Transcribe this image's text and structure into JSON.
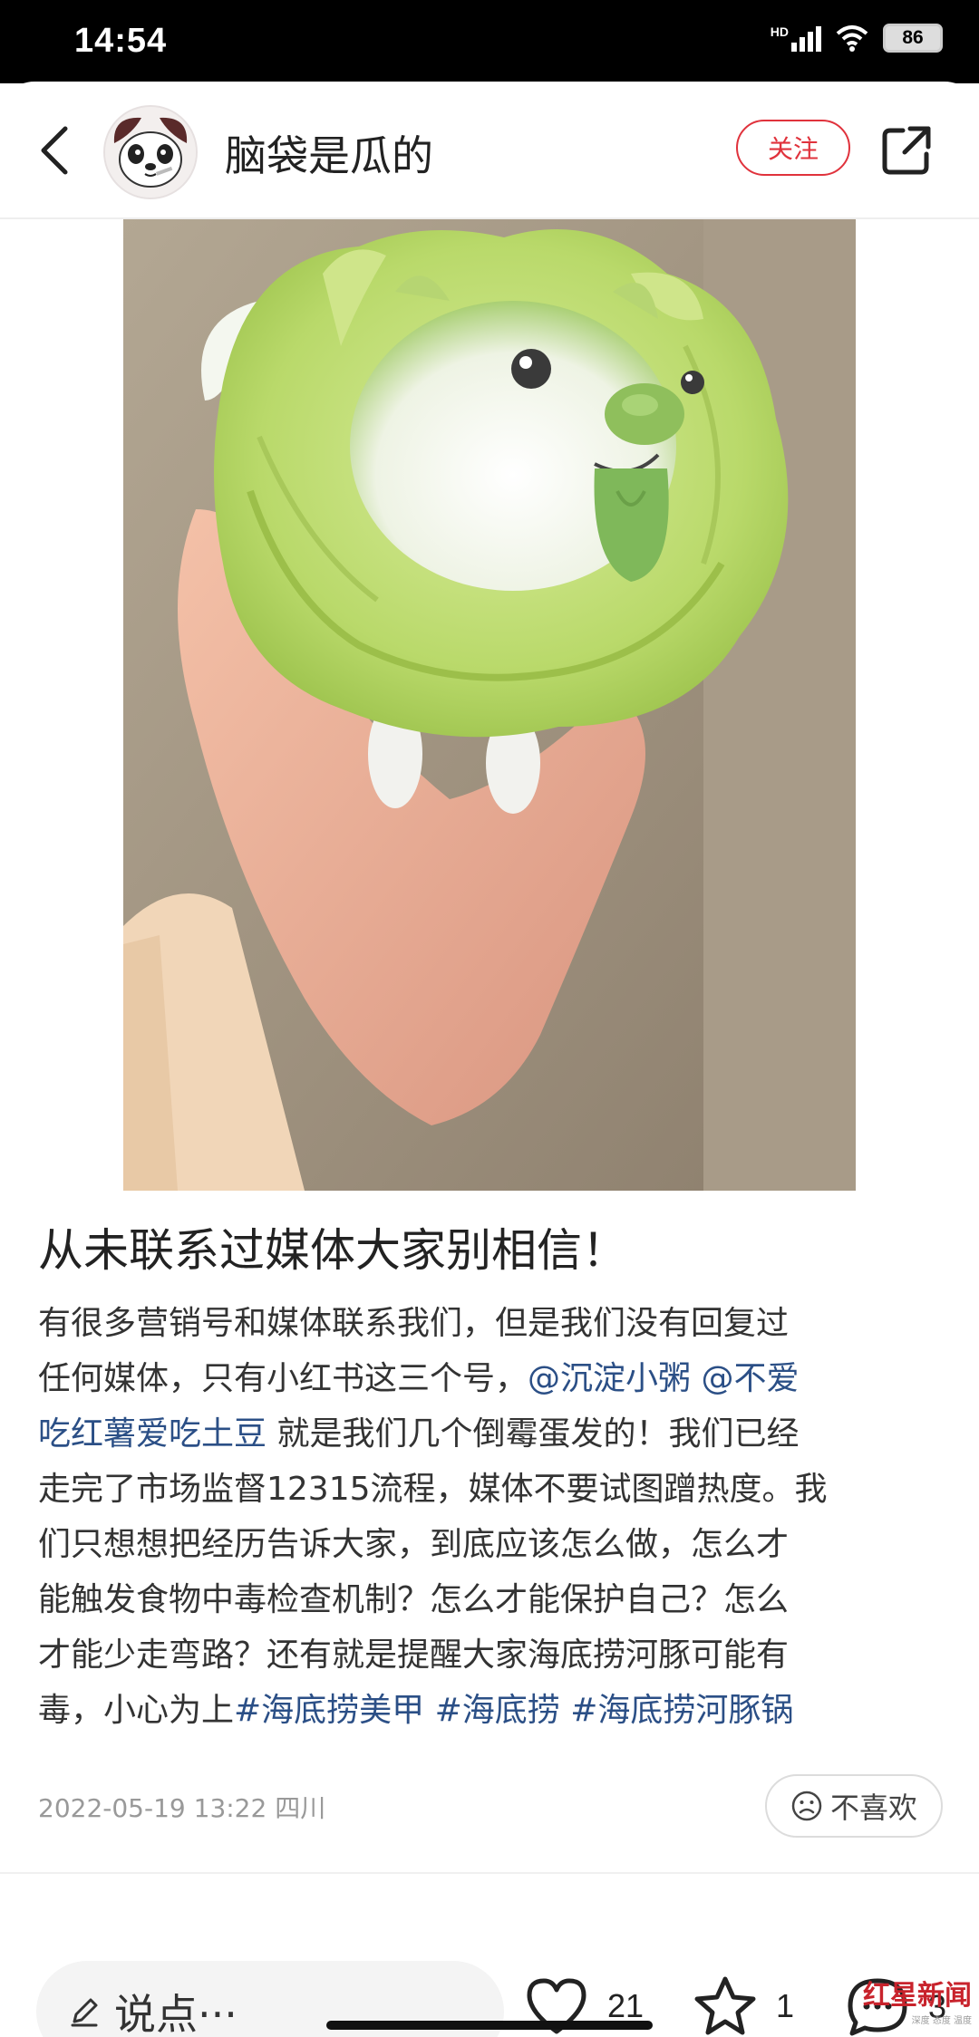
{
  "status_bar": {
    "time": "14:54",
    "network": "HD",
    "battery": "86"
  },
  "header": {
    "username": "脑袋是瓜的",
    "follow_label": "关注"
  },
  "post": {
    "image_alt": "大白菜狗公仔",
    "title": "从未联系过媒体大家别相信！",
    "lines": [
      [
        {
          "t": "有很多营销号和媒体联系我们，但是我们没有回复过"
        }
      ],
      [
        {
          "t": "任何媒体，只有小红书这三个号，"
        },
        {
          "t": "@沉淀小粥",
          "link": true
        },
        {
          "t": " "
        },
        {
          "t": "@不爱",
          "link": true
        }
      ],
      [
        {
          "t": "吃红薯爱吃土豆",
          "link": true
        },
        {
          "t": " 就是我们几个倒霉蛋发的！我们已经"
        }
      ],
      [
        {
          "t": "走完了市场监督12315流程，媒体不要试图蹭热度。我"
        }
      ],
      [
        {
          "t": "们只想想把经历告诉大家，到底应该怎么做，怎么才"
        }
      ],
      [
        {
          "t": "能触发食物中毒检查机制？怎么才能保护自己？怎么"
        }
      ],
      [
        {
          "t": "才能少走弯路？还有就是提醒大家海底捞河豚可能有"
        }
      ],
      [
        {
          "t": "毒，小心为上"
        },
        {
          "t": "#海底捞美甲",
          "link": true
        },
        {
          "t": " "
        },
        {
          "t": "#海底捞",
          "link": true
        },
        {
          "t": " "
        },
        {
          "t": "#海底捞河豚锅",
          "link": true
        }
      ]
    ],
    "date_location": "2022-05-19 13:22 四川",
    "dislike_label": "不喜欢"
  },
  "bottom_bar": {
    "comment_placeholder": "说点···",
    "likes": "21",
    "collects": "1",
    "comments": "3"
  },
  "watermark": {
    "brand": "红星新闻",
    "tagline": "深度 态度 温度"
  },
  "colors": {
    "accent": "#e0323c",
    "link": "#2b4f86",
    "meta_gray": "#999999"
  }
}
